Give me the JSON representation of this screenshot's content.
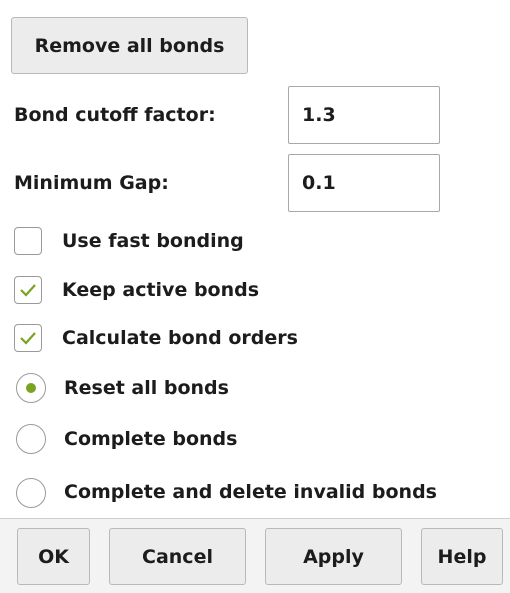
{
  "remove_all_bonds_label": "Remove all bonds",
  "cutoff": {
    "label": "Bond cutoff factor:",
    "value": "1.3"
  },
  "min_gap": {
    "label": "Minimum Gap:",
    "value": "0.1"
  },
  "checkboxes": [
    {
      "label": "Use fast bonding",
      "checked": false
    },
    {
      "label": "Keep active bonds",
      "checked": true
    },
    {
      "label": "Calculate bond orders",
      "checked": true
    }
  ],
  "radios": [
    {
      "label": "Reset all bonds",
      "selected": true
    },
    {
      "label": "Complete bonds",
      "selected": false
    },
    {
      "label": "Complete and delete invalid bonds",
      "selected": false
    }
  ],
  "buttons": {
    "ok": "OK",
    "cancel": "Cancel",
    "apply": "Apply",
    "help": "Help"
  },
  "colors": {
    "accent": "#7aa322",
    "button_bg": "#ececec",
    "footer_bg": "#f3f3f3"
  }
}
